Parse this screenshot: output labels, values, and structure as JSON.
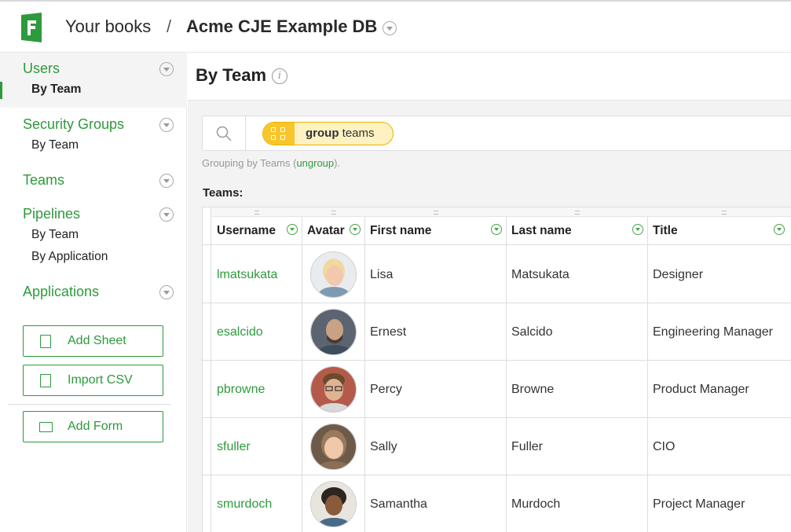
{
  "header": {
    "breadcrumb_root": "Your books",
    "separator": "/",
    "document_name": "Acme CJE Example DB"
  },
  "sidebar": {
    "sections": [
      {
        "label": "Users",
        "items": [
          "By Team"
        ]
      },
      {
        "label": "Security Groups",
        "items": [
          "By Team"
        ]
      },
      {
        "label": "Teams",
        "items": []
      },
      {
        "label": "Pipelines",
        "items": [
          "By Team",
          "By Application"
        ]
      },
      {
        "label": "Applications",
        "items": []
      }
    ],
    "buttons": {
      "add_sheet": "Add Sheet",
      "import_csv": "Import CSV",
      "add_form": "Add Form"
    },
    "accent_color": "#2e9a3c"
  },
  "main": {
    "title": "By Team",
    "search_chip": {
      "keyword": "group",
      "value": "teams"
    },
    "hint_prefix": "Grouping by Teams (",
    "hint_link": "ungroup",
    "hint_suffix": ").",
    "section_label": "Teams:",
    "columns": [
      "Username",
      "Avatar",
      "First name",
      "Last name",
      "Title"
    ],
    "rows": [
      {
        "username": "lmatsukata",
        "first": "Lisa",
        "last": "Matsukata",
        "title": "Designer"
      },
      {
        "username": "esalcido",
        "first": "Ernest",
        "last": "Salcido",
        "title": "Engineering Manager"
      },
      {
        "username": "pbrowne",
        "first": "Percy",
        "last": "Browne",
        "title": "Product Manager"
      },
      {
        "username": "sfuller",
        "first": "Sally",
        "last": "Fuller",
        "title": "CIO"
      },
      {
        "username": "smurdoch",
        "first": "Samantha",
        "last": "Murdoch",
        "title": "Project Manager"
      }
    ]
  }
}
